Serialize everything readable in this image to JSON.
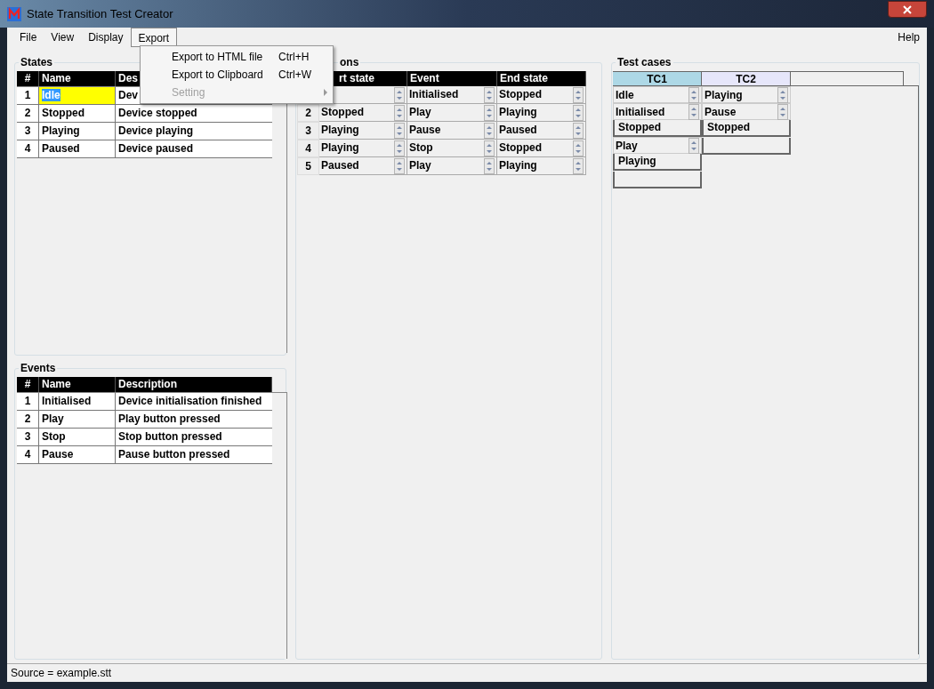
{
  "window": {
    "title": "State Transition Test Creator"
  },
  "menu": [
    {
      "label": "File",
      "open": false
    },
    {
      "label": "View",
      "open": false
    },
    {
      "label": "Display",
      "open": false
    },
    {
      "label": "Export",
      "open": true
    }
  ],
  "help": "Help",
  "dropdown": [
    {
      "label": "Export to HTML file",
      "shortcut": "Ctrl+H",
      "disabled": false
    },
    {
      "label": "Export to Clipboard",
      "shortcut": "Ctrl+W",
      "disabled": false
    },
    {
      "label": "Setting",
      "disabled": true,
      "submenu": true
    }
  ],
  "states": {
    "title": "States",
    "columns": [
      "#",
      "Name",
      "Des"
    ],
    "rows": [
      {
        "num": "1",
        "name": "Idle",
        "desc": "Dev",
        "selected": true
      },
      {
        "num": "2",
        "name": "Stopped",
        "desc": "Device stopped",
        "selected": false
      },
      {
        "num": "3",
        "name": "Playing",
        "desc": "Device playing",
        "selected": false
      },
      {
        "num": "4",
        "name": "Paused",
        "desc": "Device paused",
        "selected": false
      }
    ]
  },
  "events": {
    "title": "Events",
    "columns": [
      "#",
      "Name",
      "Description"
    ],
    "rows": [
      {
        "num": "1",
        "name": "Initialised",
        "desc": "Device initialisation finished"
      },
      {
        "num": "2",
        "name": "Play",
        "desc": "Play button pressed"
      },
      {
        "num": "3",
        "name": "Stop",
        "desc": "Stop button pressed"
      },
      {
        "num": "4",
        "name": "Pause",
        "desc": "Pause button pressed"
      }
    ]
  },
  "transitions": {
    "title": "ons",
    "columns": [
      "rt state",
      "Event",
      "End state"
    ],
    "rows": [
      {
        "event": "Initialised",
        "end": "Stopped"
      },
      {
        "num": "2",
        "start": "Stopped",
        "event": "Play",
        "end": "Playing"
      },
      {
        "num": "3",
        "start": "Playing",
        "event": "Pause",
        "end": "Paused"
      },
      {
        "num": "4",
        "start": "Playing",
        "event": "Stop",
        "end": "Stopped"
      },
      {
        "num": "5",
        "start": "Paused",
        "event": "Play",
        "end": "Playing"
      }
    ]
  },
  "test_cases": {
    "title": "Test cases",
    "cases": [
      {
        "label": "TC1",
        "color": "#add8e6",
        "steps": [
          {
            "kind": "spin",
            "text": "Idle"
          },
          {
            "kind": "spin",
            "text": "Initialised"
          },
          {
            "kind": "plain",
            "text": "Stopped"
          },
          {
            "kind": "spin",
            "text": "Play"
          },
          {
            "kind": "plain",
            "text": "Playing"
          },
          {
            "kind": "empty"
          }
        ]
      },
      {
        "label": "TC2",
        "color": "#e6e6fa",
        "steps": [
          {
            "kind": "spin",
            "text": "Playing"
          },
          {
            "kind": "spin",
            "text": "Pause"
          },
          {
            "kind": "plain",
            "text": "Stopped"
          },
          {
            "kind": "empty"
          }
        ]
      }
    ]
  },
  "status_bar": "Source = example.stt"
}
